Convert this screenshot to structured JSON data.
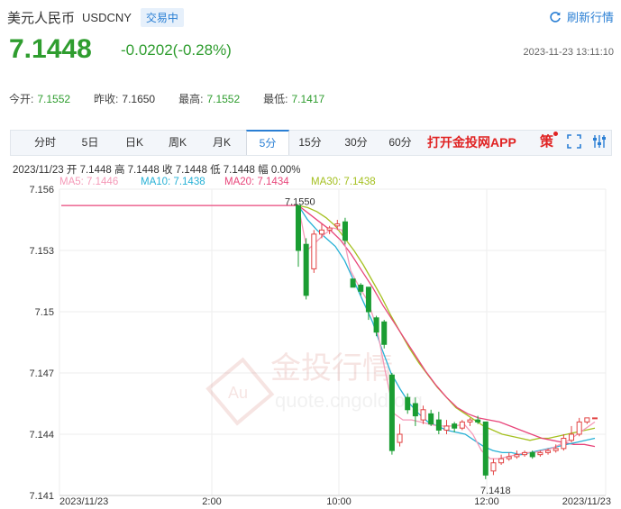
{
  "header": {
    "title": "美元人民币",
    "code": "USDCNY",
    "status": "交易中",
    "refresh": "刷新行情"
  },
  "quote": {
    "price": "7.1448",
    "change": "-0.0202(-0.28%)",
    "datetime": "2023-11-23 13:11:10"
  },
  "stats": [
    {
      "label": "今开:",
      "value": "7.1552"
    },
    {
      "label": "昨收:",
      "value": "7.1650"
    },
    {
      "label": "最高:",
      "value": "7.1552"
    },
    {
      "label": "最低:",
      "value": "7.1417"
    }
  ],
  "tabs": [
    "分时",
    "5日",
    "日K",
    "周K",
    "月K",
    "5分",
    "15分",
    "30分",
    "60分"
  ],
  "active_tab": "5分",
  "app_link": "打开金投网APP",
  "toolbar": {
    "strategy": "策"
  },
  "bar_info": "2023/11/23  开 7.1448  高 7.1448  收 7.1448  低 7.1448  幅 0.00%",
  "ma_labels": [
    {
      "text": "MA5: 7.1446",
      "color": "#f59ab8"
    },
    {
      "text": "MA10: 7.1438",
      "color": "#27b1d6"
    },
    {
      "text": "MA20: 7.1434",
      "color": "#e8457a"
    },
    {
      "text": "MA30: 7.1438",
      "color": "#a5c020"
    }
  ],
  "colors": {
    "up": "#e24444",
    "down": "#1a9d32",
    "accent": "#2a7fd4"
  },
  "watermark": {
    "text": "金投行情",
    "sub": "quote.cngold.org",
    "logo": "Au"
  },
  "chart_data": {
    "type": "candlestick",
    "y_ticks": [
      "7.156",
      "7.153",
      "7.15",
      "7.147",
      "7.144",
      "7.141"
    ],
    "y_tick_values": [
      7.156,
      7.153,
      7.15,
      7.147,
      7.144,
      7.141
    ],
    "x_labels": [
      "2023/11/23",
      "2:00",
      "10:00",
      "12:00",
      "2023/11/23"
    ],
    "annotations": [
      {
        "label": "7.1550",
        "value": 7.155
      },
      {
        "label": "7.1418",
        "value": 7.1418
      }
    ],
    "flat_line_value": 7.1552,
    "candles": [
      {
        "o": 7.1552,
        "c": 7.153,
        "h": 7.1552,
        "l": 7.1522
      },
      {
        "o": 7.1533,
        "c": 7.1508,
        "h": 7.1536,
        "l": 7.1506
      },
      {
        "o": 7.1521,
        "c": 7.1538,
        "h": 7.154,
        "l": 7.1519
      },
      {
        "o": 7.1538,
        "c": 7.154,
        "h": 7.1543,
        "l": 7.1536
      },
      {
        "o": 7.154,
        "c": 7.1541,
        "h": 7.1542,
        "l": 7.1538
      },
      {
        "o": 7.1542,
        "c": 7.1543,
        "h": 7.1545,
        "l": 7.154
      },
      {
        "o": 7.1544,
        "c": 7.1535,
        "h": 7.1546,
        "l": 7.1533
      },
      {
        "o": 7.1516,
        "c": 7.1512,
        "h": 7.1516,
        "l": 7.1512
      },
      {
        "o": 7.1513,
        "c": 7.151,
        "h": 7.1514,
        "l": 7.1508
      },
      {
        "o": 7.1512,
        "c": 7.15,
        "h": 7.1512,
        "l": 7.1496
      },
      {
        "o": 7.1497,
        "c": 7.149,
        "h": 7.1498,
        "l": 7.1488
      },
      {
        "o": 7.1495,
        "c": 7.1484,
        "h": 7.1496,
        "l": 7.1482
      },
      {
        "o": 7.1469,
        "c": 7.1432,
        "h": 7.147,
        "l": 7.143
      },
      {
        "o": 7.1436,
        "c": 7.144,
        "h": 7.1445,
        "l": 7.1434
      },
      {
        "o": 7.1458,
        "c": 7.1452,
        "h": 7.146,
        "l": 7.145
      },
      {
        "o": 7.1455,
        "c": 7.1449,
        "h": 7.1458,
        "l": 7.1444
      },
      {
        "o": 7.1447,
        "c": 7.1452,
        "h": 7.1454,
        "l": 7.1445
      },
      {
        "o": 7.145,
        "c": 7.1445,
        "h": 7.1452,
        "l": 7.1444
      },
      {
        "o": 7.1447,
        "c": 7.1442,
        "h": 7.1451,
        "l": 7.144
      },
      {
        "o": 7.1442,
        "c": 7.1444,
        "h": 7.1447,
        "l": 7.144
      },
      {
        "o": 7.1445,
        "c": 7.1443,
        "h": 7.1446,
        "l": 7.1441
      },
      {
        "o": 7.1443,
        "c": 7.1446,
        "h": 7.1447,
        "l": 7.1442
      },
      {
        "o": 7.1446,
        "c": 7.1447,
        "h": 7.1448,
        "l": 7.1444
      },
      {
        "o": 7.1447,
        "c": 7.1446,
        "h": 7.1449,
        "l": 7.1445
      },
      {
        "o": 7.1446,
        "c": 7.142,
        "h": 7.1446,
        "l": 7.1418
      },
      {
        "o": 7.1422,
        "c": 7.1426,
        "h": 7.1428,
        "l": 7.142
      },
      {
        "o": 7.1426,
        "c": 7.1428,
        "h": 7.143,
        "l": 7.1425
      },
      {
        "o": 7.1428,
        "c": 7.1429,
        "h": 7.1431,
        "l": 7.1427
      },
      {
        "o": 7.1429,
        "c": 7.143,
        "h": 7.1432,
        "l": 7.1428
      },
      {
        "o": 7.143,
        "c": 7.1431,
        "h": 7.1432,
        "l": 7.1429
      },
      {
        "o": 7.1431,
        "c": 7.1429,
        "h": 7.1432,
        "l": 7.1428
      },
      {
        "o": 7.143,
        "c": 7.1431,
        "h": 7.1432,
        "l": 7.1429
      },
      {
        "o": 7.1431,
        "c": 7.1432,
        "h": 7.1433,
        "l": 7.143
      },
      {
        "o": 7.1432,
        "c": 7.1433,
        "h": 7.1435,
        "l": 7.1431
      },
      {
        "o": 7.1433,
        "c": 7.1438,
        "h": 7.144,
        "l": 7.1432
      },
      {
        "o": 7.1437,
        "c": 7.144,
        "h": 7.1444,
        "l": 7.1436
      },
      {
        "o": 7.144,
        "c": 7.1446,
        "h": 7.1448,
        "l": 7.1439
      },
      {
        "o": 7.1446,
        "c": 7.1448,
        "h": 7.1448,
        "l": 7.1445
      },
      {
        "o": 7.1448,
        "c": 7.1448,
        "h": 7.1448,
        "l": 7.1448
      }
    ],
    "ma5": [
      7.1552,
      7.153,
      7.1534,
      7.1538,
      7.1541,
      7.154,
      7.152,
      7.1512,
      7.1505,
      7.1492,
      7.147,
      7.145,
      7.1447,
      7.1447,
      7.1446,
      7.1445,
      7.1444,
      7.1444,
      7.1444,
      7.1445,
      7.144,
      7.1432,
      7.1428,
      7.1428,
      7.1429,
      7.143,
      7.1431,
      7.1431,
      7.1432,
      7.1433,
      7.1435,
      7.1437,
      7.144,
      7.1443,
      7.1446
    ],
    "ma10": [
      7.1552,
      7.1545,
      7.154,
      7.1536,
      7.1532,
      7.1525,
      7.1515,
      7.1505,
      7.1495,
      7.1482,
      7.147,
      7.1462,
      7.1455,
      7.145,
      7.1446,
      7.1444,
      7.1442,
      7.1441,
      7.144,
      7.1437,
      7.1434,
      7.1432,
      7.1431,
      7.1431,
      7.143,
      7.1431,
      7.1432,
      7.1433,
      7.1434,
      7.1435,
      7.1436,
      7.1437,
      7.1438
    ],
    "ma20": [
      7.1552,
      7.1548,
      7.1544,
      7.154,
      7.1535,
      7.1528,
      7.152,
      7.1512,
      7.1503,
      7.1495,
      7.1487,
      7.1479,
      7.1471,
      7.1464,
      7.1458,
      7.1453,
      7.145,
      7.1448,
      7.1447,
      7.1446,
      7.1444,
      7.1442,
      7.144,
      7.1438,
      7.1437,
      7.1436,
      7.1435,
      7.1435,
      7.1434
    ],
    "ma30": [
      7.1552,
      7.1551,
      7.1549,
      7.1546,
      7.1542,
      7.1536,
      7.153,
      7.1523,
      7.1515,
      7.1507,
      7.1498,
      7.149,
      7.1482,
      7.1475,
      7.1469,
      7.1463,
      7.1458,
      7.1453,
      7.145,
      7.1447,
      7.1444,
      7.1442,
      7.144,
      7.1439,
      7.1438,
      7.1437,
      7.1438,
      7.1438,
      7.1439,
      7.144,
      7.1441,
      7.1442,
      7.1443
    ]
  }
}
